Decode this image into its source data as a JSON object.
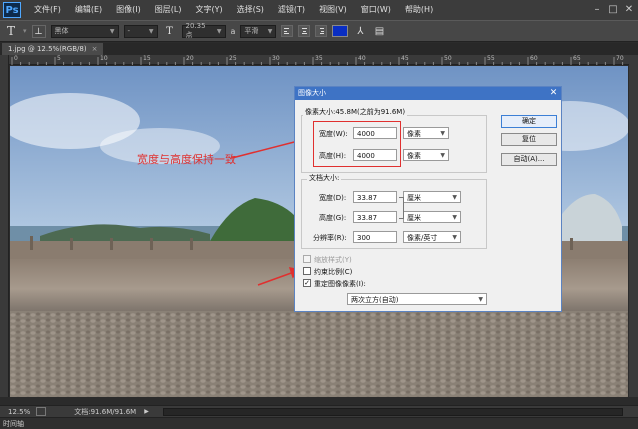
{
  "app": {
    "logo": "Ps"
  },
  "menubar": {
    "items": [
      "文件(F)",
      "编辑(E)",
      "图像(I)",
      "图层(L)",
      "文字(Y)",
      "选择(S)",
      "滤镜(T)",
      "视图(V)",
      "窗口(W)",
      "帮助(H)"
    ],
    "window_controls": [
      "–",
      "□",
      "✕"
    ]
  },
  "options": {
    "tool_glyph": "T",
    "orient_glyph": "⊥",
    "font_family": "黑体",
    "font_style": "-",
    "size_glyph": "T",
    "font_size": "20.35 点",
    "aa_glyph": "a",
    "aa_mode": "平滑",
    "warp_glyph": "⅄",
    "panel_glyph": "▤",
    "text_color": "#0a2ec2"
  },
  "document": {
    "tab": "1.jpg @ 12.5%(RGB/8)",
    "close": "×"
  },
  "ruler": {
    "ticks": [
      "0",
      "5",
      "10",
      "15",
      "20",
      "25",
      "30",
      "35",
      "40",
      "45",
      "50",
      "55",
      "60",
      "65",
      "70"
    ]
  },
  "annotation": {
    "text": "宽度与高度保持一致",
    "color": "#e0302f"
  },
  "dialog": {
    "title": "图像大小",
    "close": "✕",
    "pixel_size_label": "像素大小:45.8M(之前为91.6M)",
    "pixel_width_label": "宽度(W):",
    "pixel_width_value": "4000",
    "pixel_width_unit": "像素",
    "pixel_height_label": "高度(H):",
    "pixel_height_value": "4000",
    "pixel_height_unit": "像素",
    "doc_size_label": "文档大小:",
    "doc_width_label": "宽度(D):",
    "doc_width_value": "33.87",
    "doc_width_unit": "厘米",
    "doc_height_label": "高度(G):",
    "doc_height_value": "33.87",
    "doc_height_unit": "厘米",
    "resolution_label": "分辨率(R):",
    "resolution_value": "300",
    "resolution_unit": "像素/英寸",
    "scale_styles_label": "缩放样式(Y)",
    "constrain_label": "约束比例(C)",
    "resample_label": "重定图像像素(I):",
    "resample_method": "两次立方(自动)",
    "ok_label": "确定",
    "reset_label": "复位",
    "auto_label": "自动(A)...",
    "constrain_checked": false,
    "resample_checked": true
  },
  "status": {
    "zoom": "12.5%",
    "doc_info": "文档:91.6M/91.6M",
    "arrow": "▶",
    "bottom_label": "时间轴"
  }
}
